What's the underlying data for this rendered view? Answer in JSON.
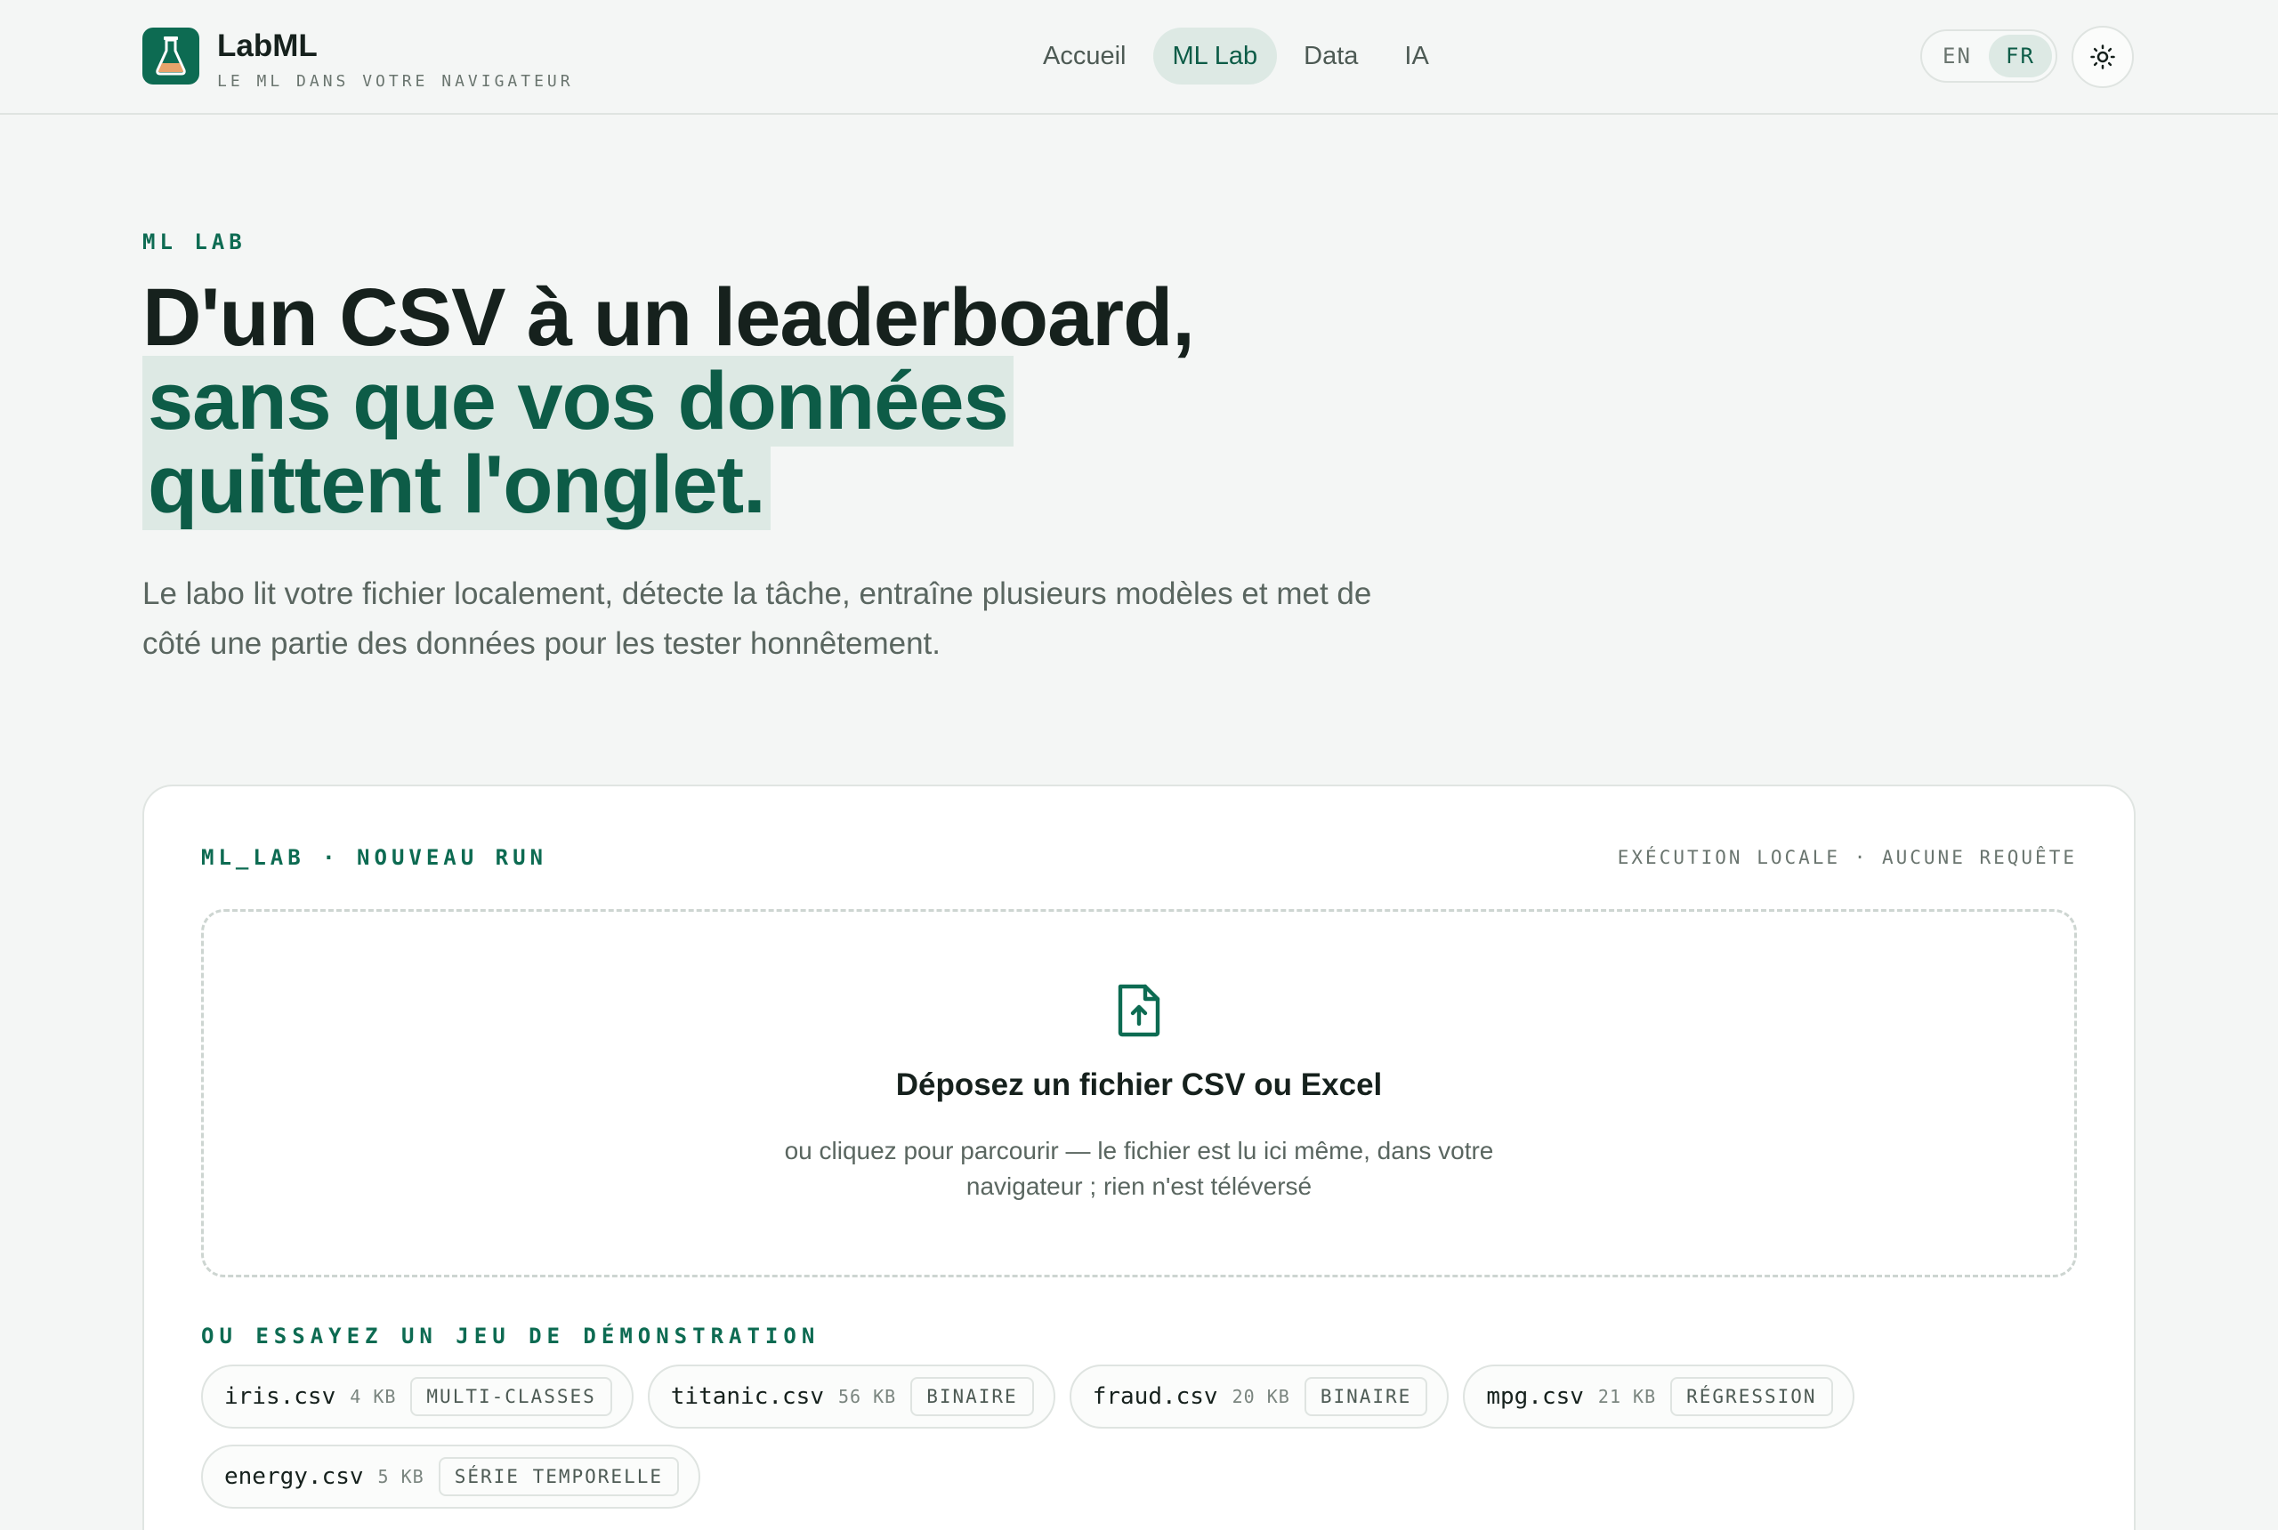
{
  "brand": {
    "name": "LabML",
    "tagline": "LE ML DANS VOTRE NAVIGATEUR",
    "logo_icon": "flask-icon"
  },
  "nav": {
    "items": [
      {
        "label": "Accueil",
        "active": false
      },
      {
        "label": "ML Lab",
        "active": true
      },
      {
        "label": "Data",
        "active": false
      },
      {
        "label": "IA",
        "active": false
      }
    ]
  },
  "lang": {
    "en": "EN",
    "fr": "FR",
    "selected": "FR"
  },
  "theme_toggle_icon": "sun-icon",
  "hero": {
    "eyebrow": "ML LAB",
    "title_plain": "D'un CSV à un leaderboard,",
    "title_highlight": "sans que vos données quittent l'onglet.",
    "subtitle": "Le labo lit votre fichier localement, détecte la tâche, entraîne plusieurs modèles et met de côté une partie des données pour les tester honnêtement."
  },
  "card": {
    "label": "ML_LAB · NOUVEAU RUN",
    "meta": "EXÉCUTION LOCALE · AUCUNE REQUÊTE",
    "dropzone": {
      "icon": "file-upload-icon",
      "title": "Déposez un fichier CSV ou Excel",
      "subtitle": "ou cliquez pour parcourir — le fichier est lu ici même, dans votre navigateur ; rien n'est téléversé"
    },
    "demo_label": "OU ESSAYEZ UN JEU DE DÉMONSTRATION",
    "datasets": [
      {
        "name": "iris.csv",
        "size": "4 KB",
        "tag": "MULTI-CLASSES"
      },
      {
        "name": "titanic.csv",
        "size": "56 KB",
        "tag": "BINAIRE"
      },
      {
        "name": "fraud.csv",
        "size": "20 KB",
        "tag": "BINAIRE"
      },
      {
        "name": "mpg.csv",
        "size": "21 KB",
        "tag": "RÉGRESSION"
      },
      {
        "name": "energy.csv",
        "size": "5 KB",
        "tag": "SÉRIE TEMPORELLE"
      }
    ]
  },
  "colors": {
    "accent": "#0d6b52",
    "accent_soft": "#dde9e4",
    "background": "#f4f6f5"
  }
}
